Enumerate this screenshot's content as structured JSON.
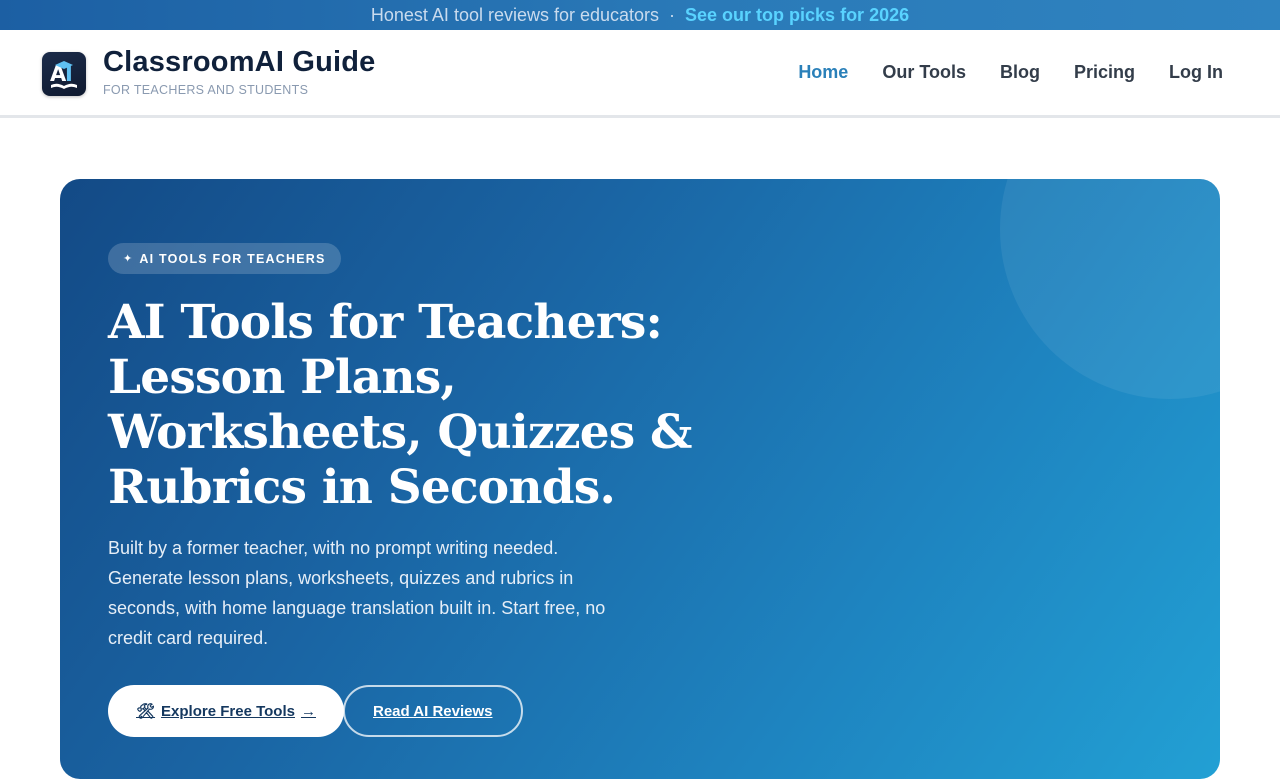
{
  "announcement": {
    "text": "Honest AI tool reviews for educators",
    "separator": "·",
    "link_label": "See our top picks for 2026"
  },
  "brand": {
    "logo_text": "AI",
    "title": "ClassroomAI Guide",
    "subtitle": "FOR TEACHERS AND STUDENTS"
  },
  "nav": {
    "items": [
      {
        "label": "Home",
        "active": true
      },
      {
        "label": "Our Tools",
        "active": false
      },
      {
        "label": "Blog",
        "active": false
      },
      {
        "label": "Pricing",
        "active": false
      },
      {
        "label": "Log In",
        "active": false
      }
    ]
  },
  "hero": {
    "badge_icon": "sparkle-icon",
    "badge_glyph": "✦",
    "badge_label": "AI TOOLS FOR TEACHERS",
    "title": "AI Tools for Teachers: Lesson Plans, Worksheets, Quizzes & Rubrics in Seconds.",
    "description": "Built by a former teacher, with no prompt writing needed. Generate lesson plans, worksheets, quizzes and rubrics in seconds, with home language translation built in. Start free, no credit card required.",
    "primary_button": {
      "icon": "tools-icon",
      "glyph": "🛠",
      "label": "Explore Free Tools",
      "trailing_glyph": "→",
      "trailing_icon": "arrow-right-icon"
    },
    "secondary_button": {
      "label": "Read AI Reviews"
    }
  },
  "colors": {
    "accent": "#2a80b9",
    "brand_dark": "#10213b",
    "announcement_link": "#59d3ff",
    "hero_start": "#134a86",
    "hero_end": "#22a0d4"
  }
}
